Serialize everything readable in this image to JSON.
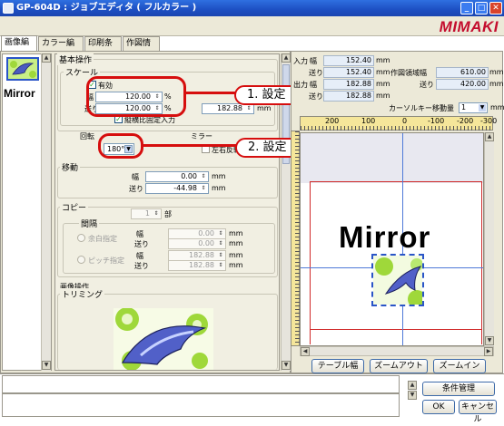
{
  "window": {
    "title": "GP-604D : ジョブエディタ ( フルカラー )",
    "brand": "MIMAKI"
  },
  "tabs": [
    {
      "label": "画像編集",
      "active": true
    },
    {
      "label": "カラー編集",
      "active": false
    },
    {
      "label": "印刷条件",
      "active": false
    },
    {
      "label": "作図情報",
      "active": false
    }
  ],
  "thumb": {
    "label": "Mirror"
  },
  "basic_ops": {
    "title": "基本操作",
    "scale": {
      "title": "スケール",
      "enabled_label": "有効",
      "width_label": "幅",
      "width_value": "120.00",
      "width_unit": "%",
      "width_mm": "182.88",
      "feed_label": "送り",
      "feed_value": "120.00",
      "feed_unit": "%",
      "feed_mm": "182.88",
      "mm_unit": "mm",
      "lock_label": "縦横比固定入力"
    },
    "rotation": {
      "title": "回転",
      "value": "180°"
    },
    "mirror": {
      "title": "ミラー",
      "check_label": "左右反転"
    }
  },
  "move": {
    "title": "移動",
    "width_label": "幅",
    "width_value": "0.00",
    "width_unit": "mm",
    "feed_label": "送り",
    "feed_value": "-44.98",
    "feed_unit": "mm"
  },
  "copy": {
    "title": "コピー",
    "count_value": "1",
    "count_unit": "部",
    "gap_title": "間隔",
    "margin_label": "余白指定",
    "pitch_label": "ピッチ指定",
    "gap_w_label": "幅",
    "gap_w": "0.00",
    "gap_f_label": "送り",
    "gap_f": "0.00",
    "pitch_w_label": "幅",
    "pitch_w": "182.88",
    "pitch_f_label": "送り",
    "pitch_f": "182.88",
    "unit": "mm"
  },
  "image_ops": {
    "title": "画像操作",
    "trim_title": "トリミング"
  },
  "callouts": {
    "c1": "1. 設定",
    "c2": "2. 設定"
  },
  "info": {
    "input_label": "入力",
    "input_w_label": "幅",
    "input_w": "152.40",
    "input_f_label": "送り",
    "input_f": "152.40",
    "output_label": "出力",
    "output_w_label": "幅",
    "output_w": "182.88",
    "output_f_label": "送り",
    "output_f": "182.88",
    "area_label": "作図領域",
    "area_w_label": "幅",
    "area_w": "610.00",
    "area_f_label": "送り",
    "area_f": "420.00",
    "unit": "mm",
    "cursor_label": "カーソルキー移動量",
    "cursor_value": "1",
    "cursor_unit": "mm"
  },
  "ruler": {
    "ticks": [
      "200",
      "100",
      "0",
      "-100",
      "-200",
      "-300"
    ]
  },
  "preview": {
    "text": "Mirror"
  },
  "buttons": {
    "table_width": "テーブル幅",
    "zoom_out": "ズームアウト",
    "zoom_in": "ズームイン"
  },
  "footer": {
    "condition": "条件管理",
    "ok": "OK",
    "cancel": "キャンセル"
  },
  "colors": {
    "accent": "#2a55c8",
    "callout": "#d60e0e",
    "brand": "#c40d2e"
  }
}
